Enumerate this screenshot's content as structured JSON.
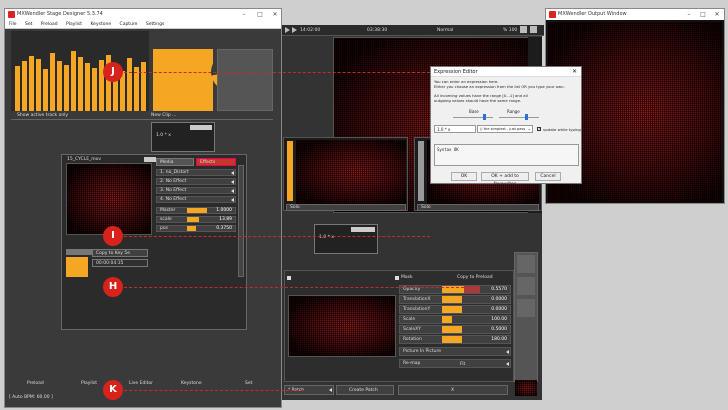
{
  "main_window": {
    "title": "MXWendler Stage Designer 5.3.74",
    "menu": [
      "File",
      "Set",
      "Preload",
      "Playlist",
      "Keystone",
      "Capture",
      "Settings"
    ]
  },
  "output_window": {
    "title": "MXWendler Output Window"
  },
  "transport": {
    "time_current": "14:02:00",
    "time_remaining": "03:38:30",
    "mode": "Normal",
    "percent": "% 100"
  },
  "left": {
    "show_active_label": "Show active track only",
    "new_clip_label": "New Clip ...",
    "expr_small": "1.0 * x",
    "clip_name": "15_CYCLE_mov",
    "tabs": {
      "media": "Media",
      "effects": "Effects"
    },
    "effects": [
      "1. no_Distort",
      "2. No Effect",
      "3. No Effect",
      "4. No Effect"
    ],
    "params": [
      {
        "label": "Master",
        "value": "1.0000",
        "fill": 1.0
      },
      {
        "label": "scale",
        "value": "13.89",
        "fill": 0.4
      },
      {
        "label": "pos",
        "value": "0.3750",
        "fill": 0.3
      }
    ],
    "copy_to_key": "Copy to Key 5e",
    "clip_time": "00:00:04:35"
  },
  "nav": {
    "preload": "Preload",
    "playlist": "Playlist",
    "live_editor": "Live Editor",
    "keystone": "Keystone",
    "set": "Set"
  },
  "status": {
    "auto_bpm": "[ Auto BPM: 60.00 ]"
  },
  "center": {
    "slot1": "Solo",
    "slot2": "Solo",
    "expr_mid": "1.0 * x",
    "copy_to_preload": "Copy to Preload",
    "mask_label": "Mask",
    "props": [
      {
        "label": "Opacity",
        "value": "0.5570",
        "fill": 0.56
      },
      {
        "label": "TranslationX",
        "value": "0.0000",
        "fill": 0.5
      },
      {
        "label": "TranslationY",
        "value": "0.0000",
        "fill": 0.5
      },
      {
        "label": "Scale",
        "value": "100.00",
        "fill": 0.25
      },
      {
        "label": "ScaleXY",
        "value": "0.5000",
        "fill": 0.5
      },
      {
        "label": "Rotation",
        "value": "180.00",
        "fill": 0.5
      }
    ],
    "pip_label": "Picture In Picture",
    "remap_label": "Re-map",
    "remap_value": "Fit",
    "patch_field": "* Patch",
    "create_patch": "Create Patch",
    "x_btn": "X"
  },
  "dialog": {
    "title": "Expression Editor",
    "line1": "You can enter an expression here.",
    "line2": "Either you choose an expression from the list OR you type your own.",
    "line3": "All incoming values have the range [0...1] and all",
    "line4": "outgoing values should have the same range.",
    "base_label": "Base",
    "range_label": "Range",
    "expression": "1.0 * x",
    "preset": "// the simplest - just pass",
    "update_label": "update while typing",
    "syntax": "Syntax OK",
    "ok": "OK",
    "ok_fav": "OK + add to favourites",
    "cancel": "Cancel"
  },
  "markers": {
    "j": "J",
    "i": "I",
    "h": "H",
    "k": "K"
  },
  "colors": {
    "accent": "#f5a623",
    "marker": "#d8231d",
    "active_tab": "#c0392b"
  }
}
